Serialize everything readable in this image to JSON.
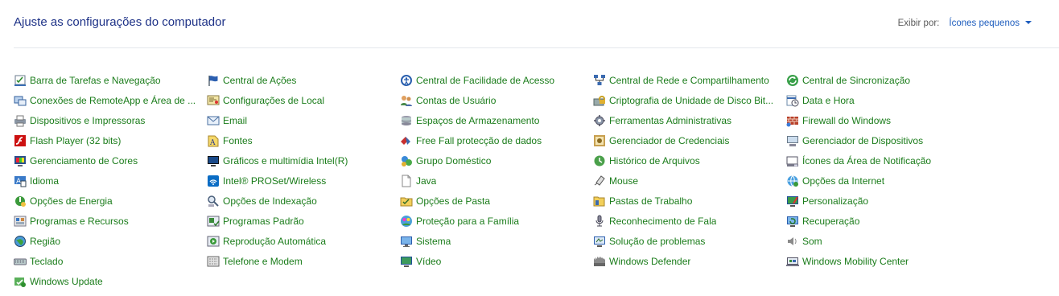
{
  "header": {
    "title": "Ajuste as configurações do computador",
    "view_by_label": "Exibir por:",
    "view_by_value": "Ícones pequenos"
  },
  "columns": [
    [
      {
        "label": "Barra de Tarefas e Navegação",
        "icon": "taskbar-icon"
      },
      {
        "label": "Conexões de RemoteApp e Área de ...",
        "icon": "remoteapp-icon"
      },
      {
        "label": "Dispositivos e Impressoras",
        "icon": "printer-icon"
      },
      {
        "label": "Flash Player (32 bits)",
        "icon": "flash-icon"
      },
      {
        "label": "Gerenciamento de Cores",
        "icon": "color-icon"
      },
      {
        "label": "Idioma",
        "icon": "language-icon"
      },
      {
        "label": "Opções de Energia",
        "icon": "power-icon"
      },
      {
        "label": "Programas e Recursos",
        "icon": "programs-icon"
      },
      {
        "label": "Região",
        "icon": "globe-icon"
      },
      {
        "label": "Teclado",
        "icon": "keyboard-icon"
      },
      {
        "label": "Windows Update",
        "icon": "windows-update-icon"
      }
    ],
    [
      {
        "label": "Central de Ações",
        "icon": "flag-icon"
      },
      {
        "label": "Configurações de Local",
        "icon": "location-icon"
      },
      {
        "label": "Email",
        "icon": "email-icon"
      },
      {
        "label": "Fontes",
        "icon": "fonts-icon"
      },
      {
        "label": "Gráficos e multimídia Intel(R)",
        "icon": "intel-graphics-icon"
      },
      {
        "label": "Intel® PROSet/Wireless",
        "icon": "wireless-icon"
      },
      {
        "label": "Opções de Indexação",
        "icon": "indexing-icon"
      },
      {
        "label": "Programas Padrão",
        "icon": "default-programs-icon"
      },
      {
        "label": "Reprodução Automática",
        "icon": "autoplay-icon"
      },
      {
        "label": "Telefone e Modem",
        "icon": "phone-icon"
      }
    ],
    [
      {
        "label": "Central de Facilidade de Acesso",
        "icon": "accessibility-icon"
      },
      {
        "label": "Contas de Usuário",
        "icon": "users-icon"
      },
      {
        "label": "Espaços de Armazenamento",
        "icon": "storage-icon"
      },
      {
        "label": "Free Fall protecção de dados",
        "icon": "freefall-icon"
      },
      {
        "label": "Grupo Doméstico",
        "icon": "homegroup-icon"
      },
      {
        "label": "Java",
        "icon": "document-icon"
      },
      {
        "label": "Opções de Pasta",
        "icon": "folder-options-icon"
      },
      {
        "label": "Proteção para a Família",
        "icon": "family-icon"
      },
      {
        "label": "Sistema",
        "icon": "system-icon"
      },
      {
        "label": "Vídeo",
        "icon": "display-icon"
      }
    ],
    [
      {
        "label": "Central de Rede e Compartilhamento",
        "icon": "network-icon"
      },
      {
        "label": "Criptografia de Unidade de Disco Bit...",
        "icon": "bitlocker-icon"
      },
      {
        "label": "Ferramentas Administrativas",
        "icon": "admin-tools-icon"
      },
      {
        "label": "Gerenciador de Credenciais",
        "icon": "credentials-icon"
      },
      {
        "label": "Histórico de Arquivos",
        "icon": "file-history-icon"
      },
      {
        "label": "Mouse",
        "icon": "mouse-icon"
      },
      {
        "label": "Pastas de Trabalho",
        "icon": "work-folders-icon"
      },
      {
        "label": "Reconhecimento de Fala",
        "icon": "microphone-icon"
      },
      {
        "label": "Solução de problemas",
        "icon": "troubleshoot-icon"
      },
      {
        "label": "Windows Defender",
        "icon": "defender-icon"
      }
    ],
    [
      {
        "label": "Central de Sincronização",
        "icon": "sync-icon"
      },
      {
        "label": "Data e Hora",
        "icon": "clock-icon"
      },
      {
        "label": "Firewall do Windows",
        "icon": "firewall-icon"
      },
      {
        "label": "Gerenciador de Dispositivos",
        "icon": "device-manager-icon"
      },
      {
        "label": "Ícones da Área de Notificação",
        "icon": "notification-icon"
      },
      {
        "label": "Opções da Internet",
        "icon": "internet-icon"
      },
      {
        "label": "Personalização",
        "icon": "personalization-icon"
      },
      {
        "label": "Recuperação",
        "icon": "recovery-icon"
      },
      {
        "label": "Som",
        "icon": "speaker-icon"
      },
      {
        "label": "Windows Mobility Center",
        "icon": "mobility-icon"
      }
    ]
  ]
}
